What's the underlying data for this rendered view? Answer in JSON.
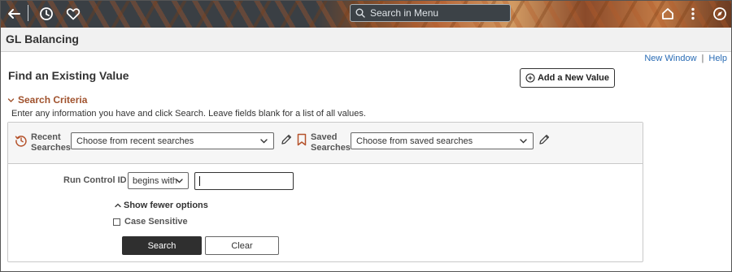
{
  "header": {
    "search_placeholder": "Search in Menu",
    "icons": [
      "back-arrow-icon",
      "history-icon",
      "favorites-heart-icon",
      "search-icon",
      "home-icon",
      "more-vertical-icon",
      "navigator-compass-icon"
    ]
  },
  "page": {
    "title": "GL Balancing",
    "links": {
      "new_window": "New Window",
      "separator": "|",
      "help": "Help"
    },
    "find_title": "Find an Existing Value",
    "add_button": "Add a New Value"
  },
  "search_criteria": {
    "heading": "Search Criteria",
    "hint": "Enter any information you have and click Search. Leave fields blank for a list of all values.",
    "recent": {
      "label_line1": "Recent",
      "label_line2": "Searches",
      "value": "Choose from recent searches"
    },
    "saved": {
      "label_line1": "Saved",
      "label_line2": "Searches",
      "value": "Choose from saved searches"
    },
    "run_control": {
      "label": "Run Control ID",
      "operator": "begins with",
      "value": ""
    },
    "fewer_options": "Show fewer options",
    "case_sensitive": {
      "label": "Case Sensitive",
      "checked": false
    },
    "search_button": "Search",
    "clear_button": "Clear"
  },
  "colors": {
    "accent_orange": "#a0522d",
    "link_blue": "#2a6cb5",
    "primary_button": "#2f2f2f"
  }
}
